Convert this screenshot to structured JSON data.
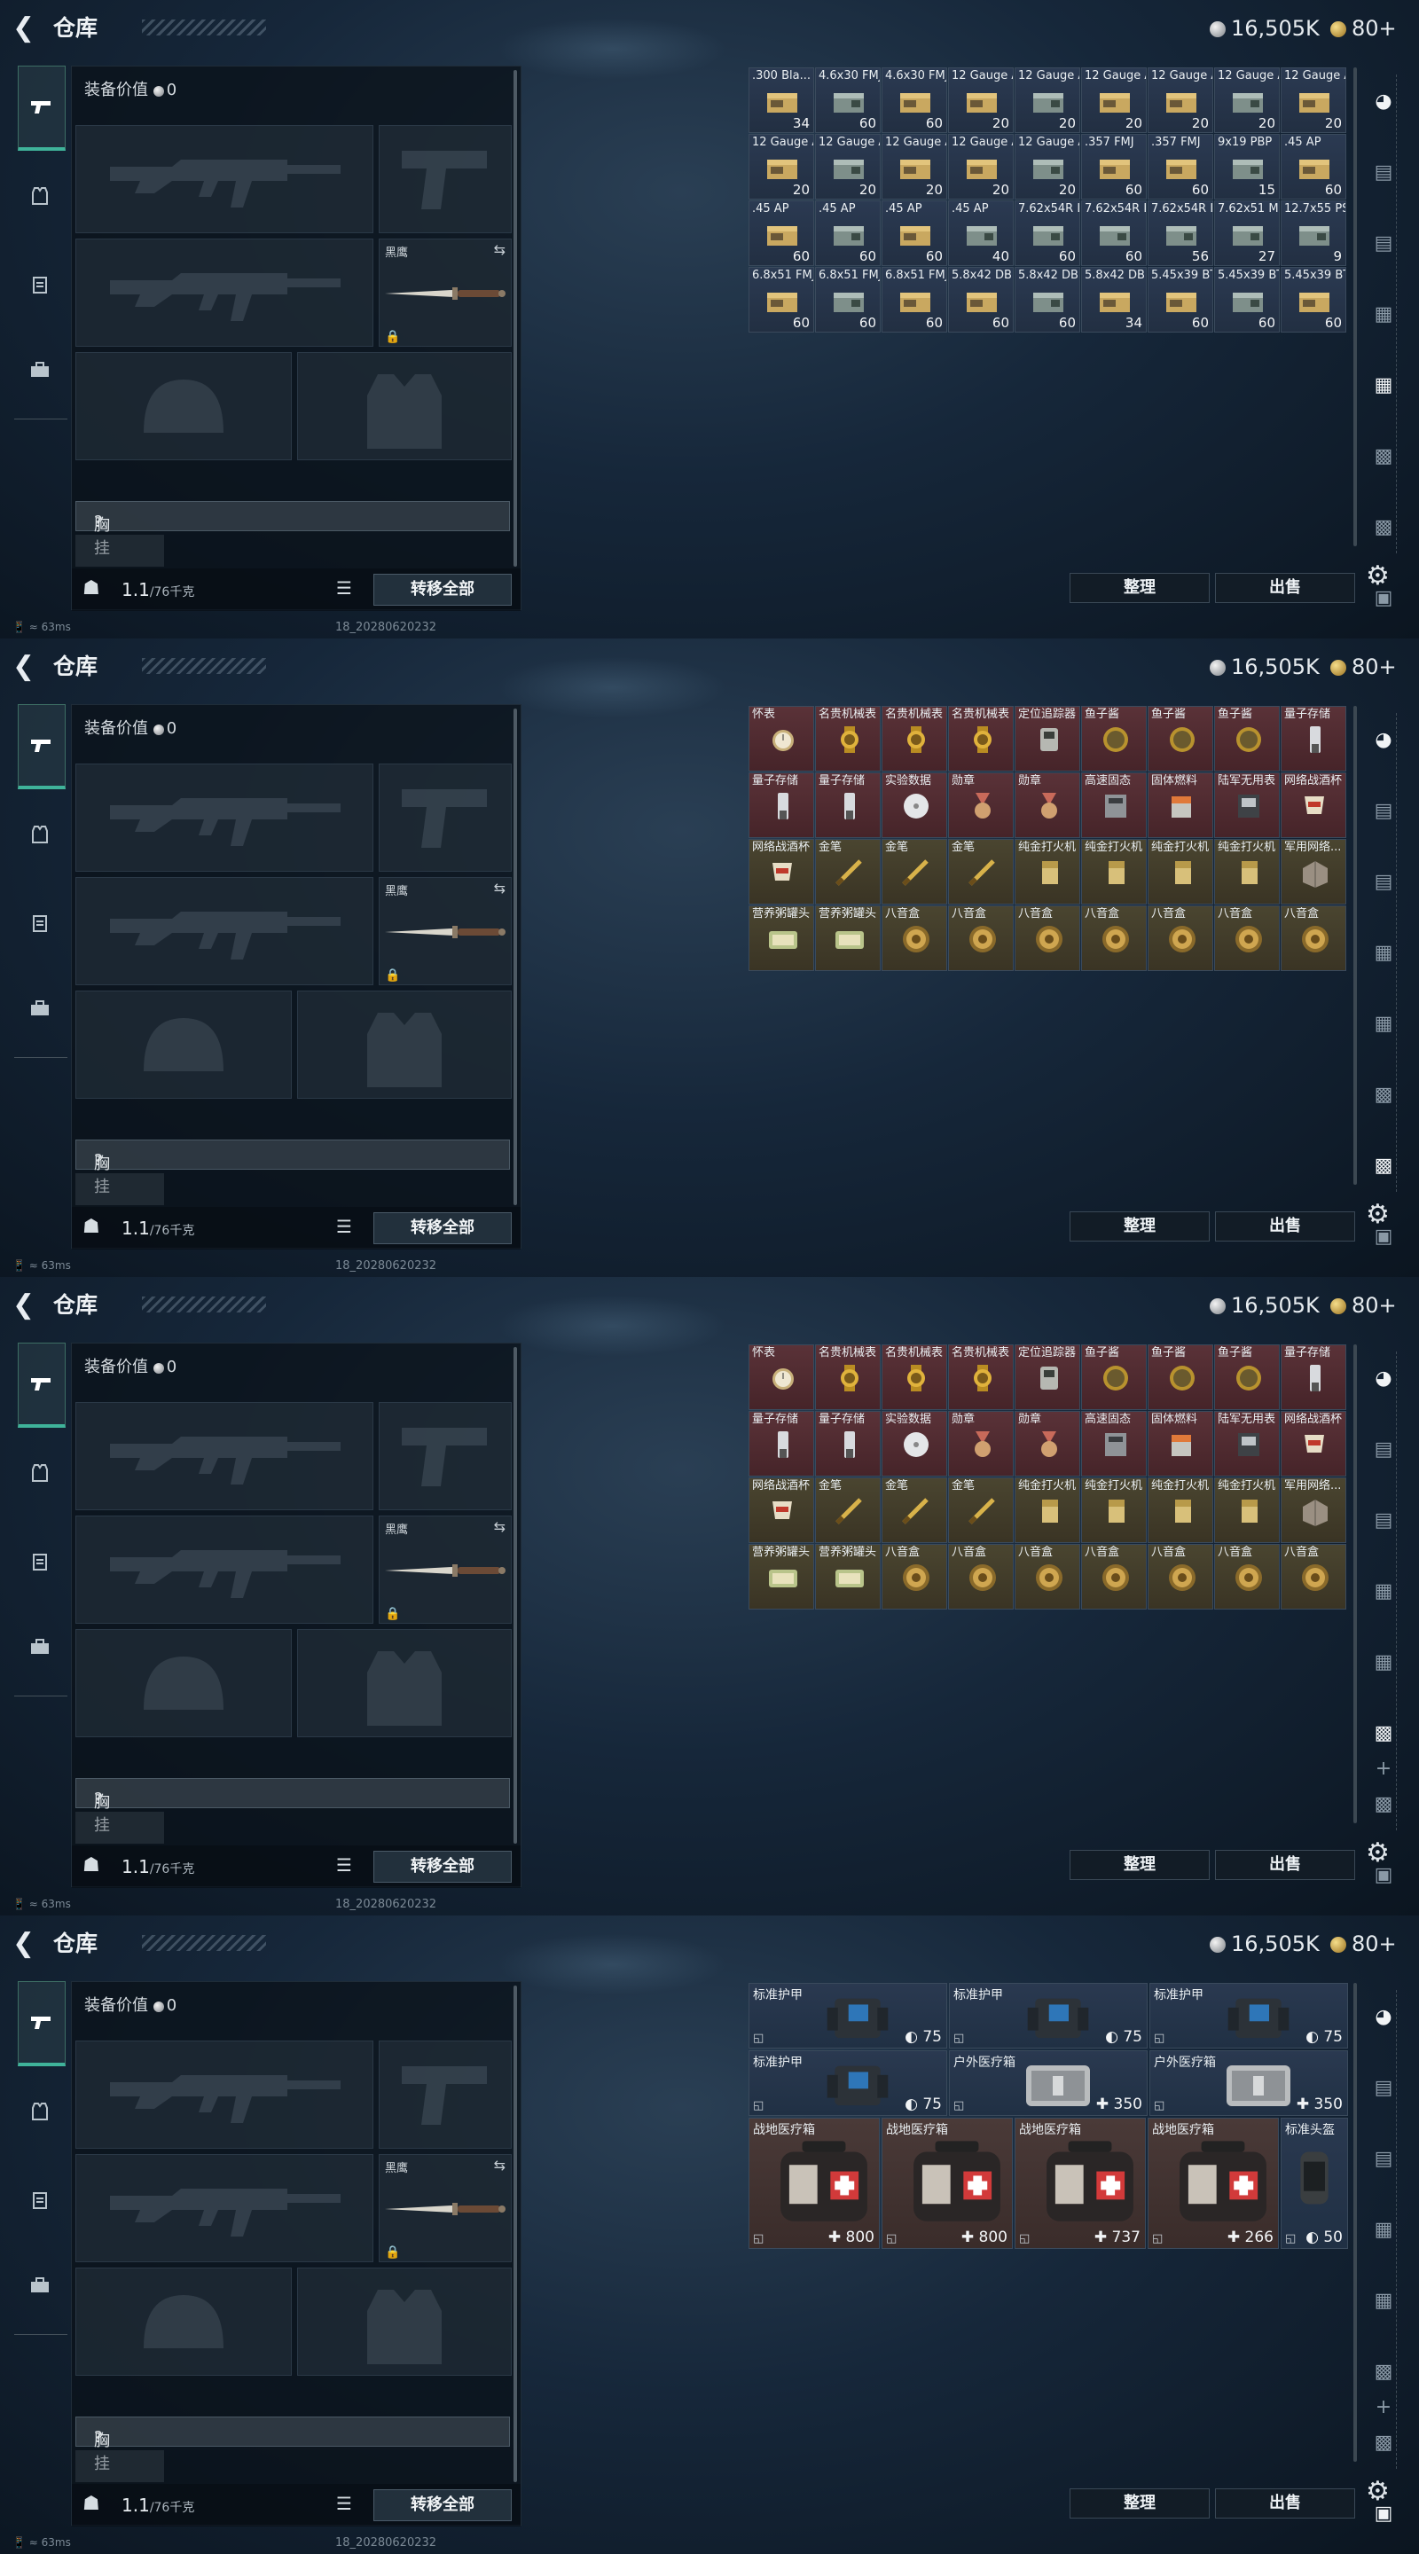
{
  "header": {
    "back_icon": "back-chevron-icon",
    "title": "仓库",
    "money": "16,505K",
    "gems": "80+"
  },
  "left": {
    "equip_value_label": "装备价值",
    "equip_value": "0",
    "melee_name": "黑鹰",
    "chest_label": "胸挂",
    "chest_q": "?",
    "weight": "1.1",
    "weight_cap": "/76千克",
    "transfer_label": "转移全部"
  },
  "right": {
    "sort_label": "整理",
    "sell_label": "出售"
  },
  "footer": {
    "ping": "63ms",
    "version": "18_20280620232"
  },
  "screens": [
    {
      "type": "ammo",
      "items": [
        {
          "n": ".300 Bla... BCP FMJ",
          "c": "34"
        },
        {
          "n": "4.6x30 FMJ SX",
          "c": "60"
        },
        {
          "n": "4.6x30 FMJ SX",
          "c": "60"
        },
        {
          "n": "12 Gauge AP-20",
          "c": "20"
        },
        {
          "n": "12 Gauge AP-20",
          "c": "20"
        },
        {
          "n": "12 Gauge AP-20",
          "c": "20"
        },
        {
          "n": "12 Gauge AP-20",
          "c": "20"
        },
        {
          "n": "12 Gauge AP-20",
          "c": "20"
        },
        {
          "n": "12 Gauge AP-20",
          "c": "20"
        },
        {
          "n": "12 Gauge AP-20",
          "c": "20"
        },
        {
          "n": "12 Gauge AP-20",
          "c": "20"
        },
        {
          "n": "12 Gauge AP-20",
          "c": "20"
        },
        {
          "n": "12 Gauge AP-20",
          "c": "20"
        },
        {
          "n": "12 Gauge AP-20",
          "c": "20"
        },
        {
          "n": ".357 FMJ",
          "c": "60"
        },
        {
          "n": ".357 FMJ",
          "c": "60"
        },
        {
          "n": "9x19 PBP",
          "c": "15"
        },
        {
          "n": ".45 AP",
          "c": "60"
        },
        {
          "n": ".45 AP",
          "c": "60"
        },
        {
          "n": ".45 AP",
          "c": "60"
        },
        {
          "n": ".45 AP",
          "c": "60"
        },
        {
          "n": ".45 AP",
          "c": "40"
        },
        {
          "n": "7.62x54R LPS",
          "c": "60"
        },
        {
          "n": "7.62x54R LPS",
          "c": "60"
        },
        {
          "n": "7.62x54R LPS",
          "c": "56"
        },
        {
          "n": "7.62x51 M80",
          "c": "27"
        },
        {
          "n": "12.7x55 PS12",
          "c": "9"
        },
        {
          "n": "6.8x51 FMJ",
          "c": "60"
        },
        {
          "n": "6.8x51 FMJ",
          "c": "60"
        },
        {
          "n": "6.8x51 FMJ",
          "c": "60"
        },
        {
          "n": "5.8x42 DBP10",
          "c": "60"
        },
        {
          "n": "5.8x42 DBP10",
          "c": "60"
        },
        {
          "n": "5.8x42 DBP10",
          "c": "34"
        },
        {
          "n": "5.45x39 BT",
          "c": "60"
        },
        {
          "n": "5.45x39 BT",
          "c": "60"
        },
        {
          "n": "5.45x39 BT",
          "c": "60"
        }
      ]
    },
    {
      "type": "valuables",
      "items": [
        {
          "n": "怀表",
          "k": "watch"
        },
        {
          "n": "名贵机械表",
          "k": "goldwatch"
        },
        {
          "n": "名贵机械表",
          "k": "goldwatch"
        },
        {
          "n": "名贵机械表",
          "k": "goldwatch"
        },
        {
          "n": "定位追踪器",
          "k": "tracker"
        },
        {
          "n": "鱼子酱",
          "k": "tin"
        },
        {
          "n": "鱼子酱",
          "k": "tin"
        },
        {
          "n": "鱼子酱",
          "k": "tin"
        },
        {
          "n": "量子存储",
          "k": "usb"
        },
        {
          "n": "量子存储",
          "k": "usb"
        },
        {
          "n": "量子存储",
          "k": "usb"
        },
        {
          "n": "实验数据",
          "k": "disc"
        },
        {
          "n": "勋章",
          "k": "medal"
        },
        {
          "n": "勋章",
          "k": "medal"
        },
        {
          "n": "高速固态",
          "k": "ssd"
        },
        {
          "n": "固体燃料",
          "k": "fuel"
        },
        {
          "n": "陆军无用表",
          "k": "box"
        },
        {
          "n": "网络战酒杯",
          "k": "cup"
        },
        {
          "n": "网络战酒杯",
          "k": "cup"
        },
        {
          "n": "金笔",
          "k": "pen"
        },
        {
          "n": "金笔",
          "k": "pen"
        },
        {
          "n": "金笔",
          "k": "pen"
        },
        {
          "n": "纯金打火机",
          "k": "lighter"
        },
        {
          "n": "纯金打火机",
          "k": "lighter"
        },
        {
          "n": "纯金打火机",
          "k": "lighter"
        },
        {
          "n": "纯金打火机",
          "k": "lighter"
        },
        {
          "n": "军用网络...",
          "k": "crate"
        },
        {
          "n": "营养粥罐头",
          "k": "can"
        },
        {
          "n": "营养粥罐头",
          "k": "can"
        },
        {
          "n": "八音盒",
          "k": "musicbox"
        },
        {
          "n": "八音盒",
          "k": "musicbox"
        },
        {
          "n": "八音盒",
          "k": "musicbox"
        },
        {
          "n": "八音盒",
          "k": "musicbox"
        },
        {
          "n": "八音盒",
          "k": "musicbox"
        },
        {
          "n": "八音盒",
          "k": "musicbox"
        },
        {
          "n": "八音盒",
          "k": "musicbox"
        }
      ]
    },
    {
      "type": "valuables",
      "items": [
        {
          "n": "怀表",
          "k": "watch"
        },
        {
          "n": "名贵机械表",
          "k": "goldwatch"
        },
        {
          "n": "名贵机械表",
          "k": "goldwatch"
        },
        {
          "n": "名贵机械表",
          "k": "goldwatch"
        },
        {
          "n": "定位追踪器",
          "k": "tracker"
        },
        {
          "n": "鱼子酱",
          "k": "tin"
        },
        {
          "n": "鱼子酱",
          "k": "tin"
        },
        {
          "n": "鱼子酱",
          "k": "tin"
        },
        {
          "n": "量子存储",
          "k": "usb"
        },
        {
          "n": "量子存储",
          "k": "usb"
        },
        {
          "n": "量子存储",
          "k": "usb"
        },
        {
          "n": "实验数据",
          "k": "disc"
        },
        {
          "n": "勋章",
          "k": "medal"
        },
        {
          "n": "勋章",
          "k": "medal"
        },
        {
          "n": "高速固态",
          "k": "ssd"
        },
        {
          "n": "固体燃料",
          "k": "fuel"
        },
        {
          "n": "陆军无用表",
          "k": "box"
        },
        {
          "n": "网络战酒杯",
          "k": "cup"
        },
        {
          "n": "网络战酒杯",
          "k": "cup"
        },
        {
          "n": "金笔",
          "k": "pen"
        },
        {
          "n": "金笔",
          "k": "pen"
        },
        {
          "n": "金笔",
          "k": "pen"
        },
        {
          "n": "纯金打火机",
          "k": "lighter"
        },
        {
          "n": "纯金打火机",
          "k": "lighter"
        },
        {
          "n": "纯金打火机",
          "k": "lighter"
        },
        {
          "n": "纯金打火机",
          "k": "lighter"
        },
        {
          "n": "军用网络...",
          "k": "crate"
        },
        {
          "n": "营养粥罐头",
          "k": "can"
        },
        {
          "n": "营养粥罐头",
          "k": "can"
        },
        {
          "n": "八音盒",
          "k": "musicbox"
        },
        {
          "n": "八音盒",
          "k": "musicbox"
        },
        {
          "n": "八音盒",
          "k": "musicbox"
        },
        {
          "n": "八音盒",
          "k": "musicbox"
        },
        {
          "n": "八音盒",
          "k": "musicbox"
        },
        {
          "n": "八音盒",
          "k": "musicbox"
        },
        {
          "n": "八音盒",
          "k": "musicbox"
        }
      ]
    },
    {
      "type": "gear",
      "items": [
        {
          "n": "标准护甲",
          "v": "75",
          "k": "armor",
          "tag": "shield"
        },
        {
          "n": "标准护甲",
          "v": "75",
          "k": "armor",
          "tag": "shield"
        },
        {
          "n": "标准护甲",
          "v": "75",
          "k": "armor",
          "tag": "shield"
        },
        {
          "n": "标准护甲",
          "v": "75",
          "k": "armor",
          "tag": "shield"
        },
        {
          "n": "户外医疗箱",
          "v": "350",
          "k": "medcase",
          "tag": "plus"
        },
        {
          "n": "户外医疗箱",
          "v": "350",
          "k": "medcase",
          "tag": "plus"
        },
        {
          "n": "战地医疗箱",
          "v": "800",
          "k": "medbag",
          "tag": "plus"
        },
        {
          "n": "战地医疗箱",
          "v": "800",
          "k": "medbag",
          "tag": "plus"
        },
        {
          "n": "战地医疗箱",
          "v": "737",
          "k": "medbag",
          "tag": "plus"
        },
        {
          "n": "战地医疗箱",
          "v": "266",
          "k": "medbag",
          "tag": "plus"
        },
        {
          "n": "标准头盔",
          "v": "50",
          "k": "helmet",
          "tag": "shield"
        }
      ]
    }
  ]
}
